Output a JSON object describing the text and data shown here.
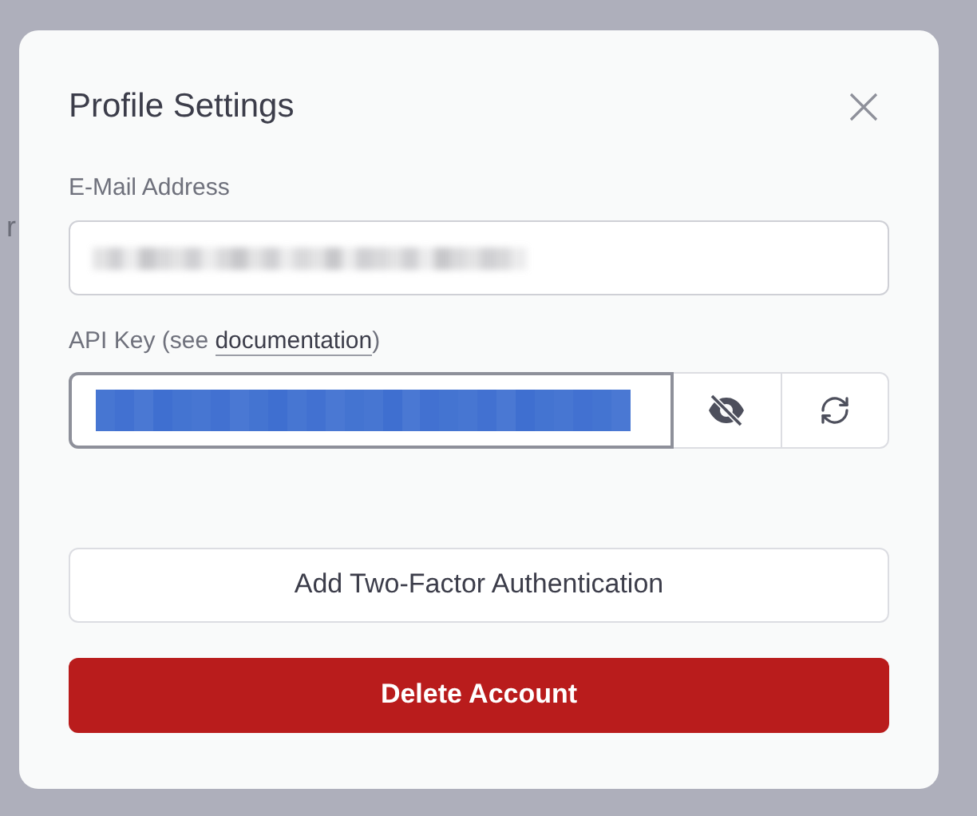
{
  "background": {
    "text_fragment": "r"
  },
  "dialog": {
    "title": "Profile Settings",
    "email": {
      "label": "E-Mail Address",
      "redacted": true
    },
    "api_key": {
      "label_prefix": "API Key (see ",
      "link": "documentation",
      "label_suffix": ")",
      "redacted": true,
      "selected": true
    },
    "buttons": [
      {
        "label": "Add Two-Factor Authentication",
        "kind": "secondary"
      },
      {
        "label": "Delete Account",
        "kind": "danger"
      }
    ]
  }
}
